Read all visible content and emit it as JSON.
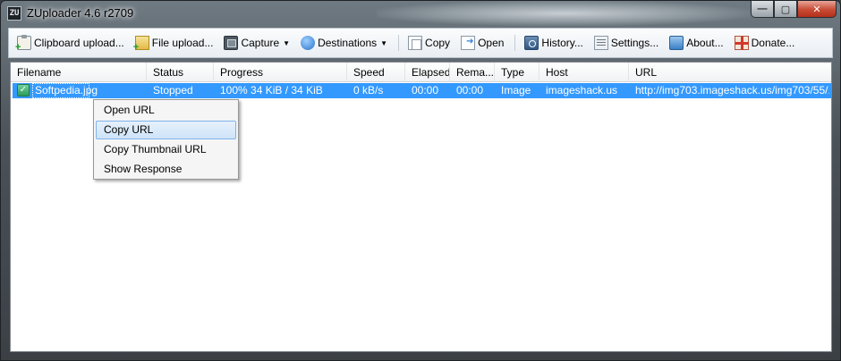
{
  "window": {
    "title": "ZUploader 4.6 r2709",
    "app_icon_text": "ZU"
  },
  "caption_buttons": {
    "minimize": "—",
    "maximize": "▢",
    "close": "✕"
  },
  "toolbar": {
    "clipboard_upload": "Clipboard upload...",
    "file_upload": "File upload...",
    "capture": "Capture",
    "destinations": "Destinations",
    "copy": "Copy",
    "open": "Open",
    "history": "History...",
    "settings": "Settings...",
    "about": "About...",
    "donate": "Donate...",
    "dropdown_caret": "▼"
  },
  "list": {
    "columns": [
      "Filename",
      "Status",
      "Progress",
      "Speed",
      "Elapsed",
      "Rema...",
      "Type",
      "Host",
      "URL"
    ],
    "rows": [
      {
        "status_icon": "check-icon",
        "filename": "Softpedia.jpg",
        "status": "Stopped",
        "progress": "100%  34 KiB / 34 KiB",
        "speed": "0 kB/s",
        "elapsed": "00:00",
        "remaining": "00:00",
        "type": "Image",
        "host": "imageshack.us",
        "url": "http://img703.imageshack.us/img703/55/..."
      }
    ]
  },
  "context_menu": {
    "items": [
      "Open URL",
      "Copy URL",
      "Copy Thumbnail URL",
      "Show Response"
    ],
    "highlighted": "Copy URL"
  },
  "colors": {
    "selection": "#3399ff",
    "menu_highlight": "#cfe3f8",
    "close_button": "#c74b34"
  },
  "check_glyph": "✓"
}
